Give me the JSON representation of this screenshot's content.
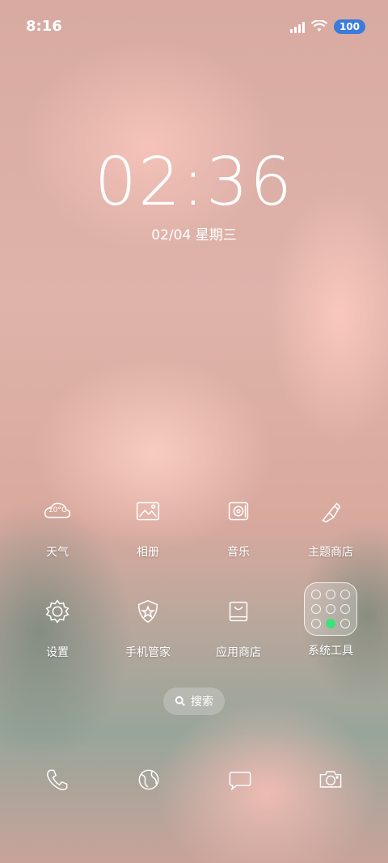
{
  "status_bar": {
    "time": "8:16",
    "battery": "100"
  },
  "lockscreen": {
    "clock": "02:36",
    "date": "02/04 星期三"
  },
  "apps": [
    {
      "label": "天气",
      "icon": "weather-icon",
      "icon_text": "10°C"
    },
    {
      "label": "相册",
      "icon": "gallery-icon"
    },
    {
      "label": "音乐",
      "icon": "music-icon"
    },
    {
      "label": "主题商店",
      "icon": "theme-store-icon"
    },
    {
      "label": "设置",
      "icon": "settings-gear-icon"
    },
    {
      "label": "手机管家",
      "icon": "phone-manager-shield-icon"
    },
    {
      "label": "应用商店",
      "icon": "app-store-bag-icon"
    },
    {
      "label": "系统工具",
      "icon": "system-tools-folder-icon"
    }
  ],
  "search": {
    "label": "搜索"
  },
  "dock": [
    {
      "icon": "phone-icon"
    },
    {
      "icon": "browser-globe-icon"
    },
    {
      "icon": "messages-icon"
    },
    {
      "icon": "camera-icon"
    }
  ],
  "colors": {
    "battery_badge": "#3a7bdc",
    "folder_active_dot": "#3ee07a"
  }
}
